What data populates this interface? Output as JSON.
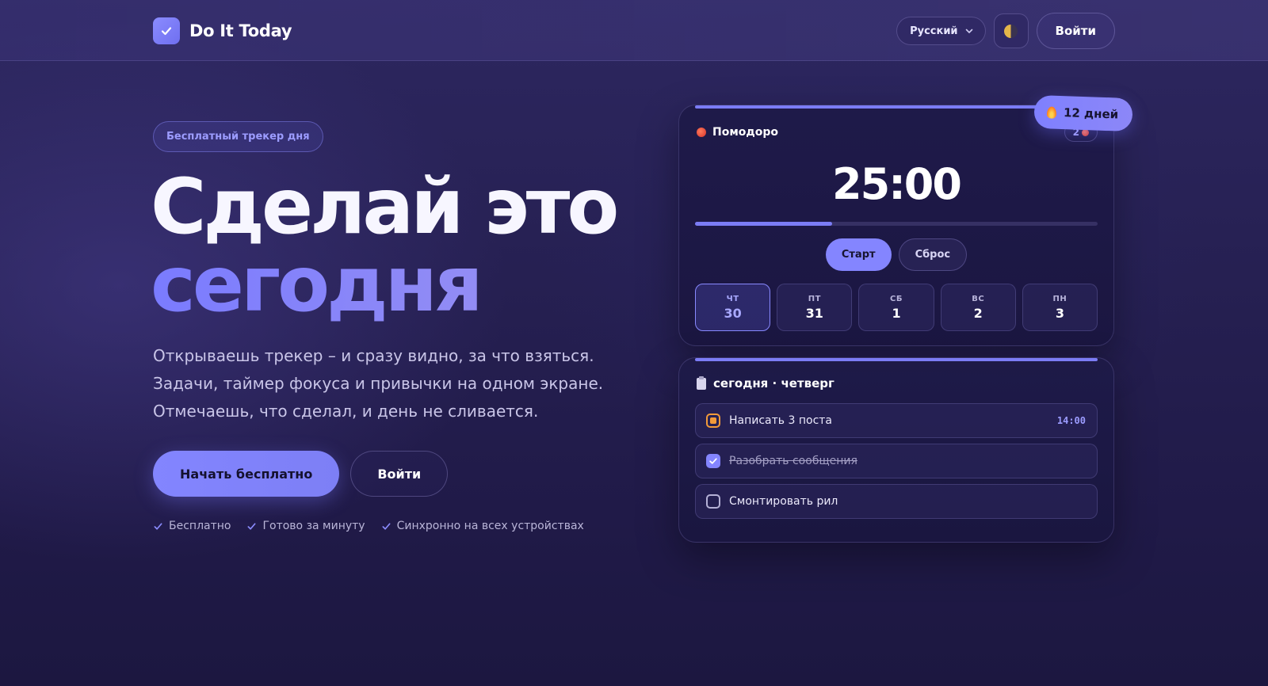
{
  "header": {
    "brand": "Do It Today",
    "language": "Русский",
    "login": "Войти"
  },
  "hero": {
    "badge": "Бесплатный трекер дня",
    "title_line1": "Сделай это",
    "title_line2": "сегодня",
    "subtitle": "Открываешь трекер – и сразу видно, за что взяться. Задачи, таймер фокуса и привычки на одном экране. Отмечаешь, что сделал, и день не сливается.",
    "cta_primary": "Начать бесплатно",
    "cta_secondary": "Войти",
    "perks": [
      "Бесплатно",
      "Готово за минуту",
      "Синхронно на всех устройствах"
    ]
  },
  "pomodoro": {
    "title": "Помодоро",
    "count": "2",
    "streak": "12 дней",
    "timer": "25:00",
    "progress": 0.34,
    "start": "Старт",
    "reset": "Сброс",
    "days": [
      {
        "name": "ЧТ",
        "num": "30",
        "active": true
      },
      {
        "name": "ПТ",
        "num": "31",
        "active": false
      },
      {
        "name": "СБ",
        "num": "1",
        "active": false
      },
      {
        "name": "ВС",
        "num": "2",
        "active": false
      },
      {
        "name": "ПН",
        "num": "3",
        "active": false
      }
    ]
  },
  "tasks": {
    "title": "сегодня · четверг",
    "items": [
      {
        "text": "Написать 3 поста",
        "state": "in-progress",
        "time": "14:00"
      },
      {
        "text": "Разобрать сообщения",
        "state": "done",
        "time": ""
      },
      {
        "text": "Смонтировать рил",
        "state": "todo",
        "time": ""
      }
    ]
  },
  "colors": {
    "accent": "#8485ff",
    "background": "#241e50",
    "in_progress": "#f29a3a"
  }
}
